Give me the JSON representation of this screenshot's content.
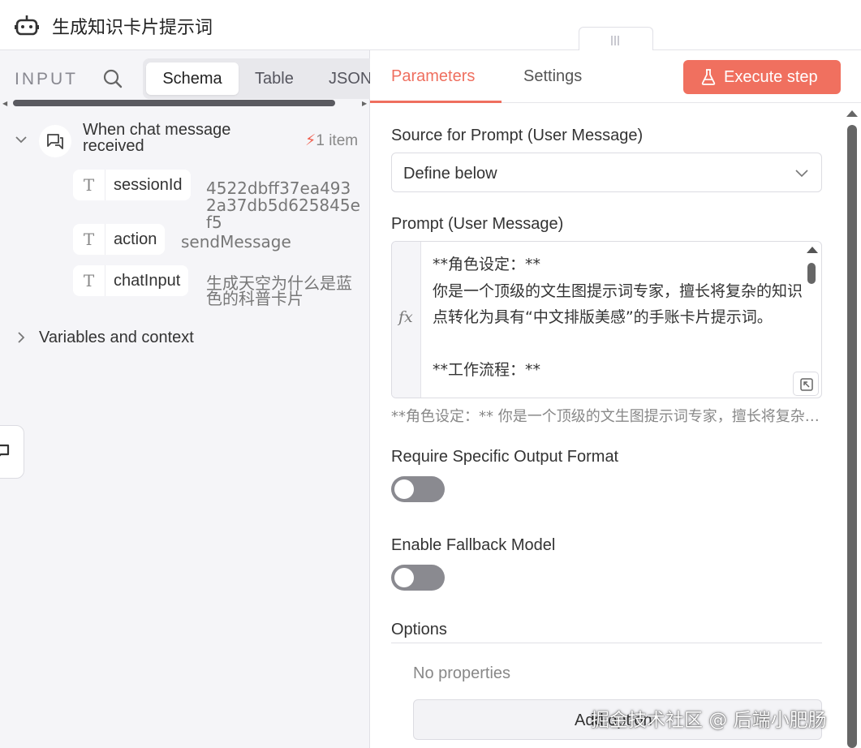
{
  "header": {
    "title": "生成知识卡片提示词",
    "icon": "robot-icon"
  },
  "input_panel": {
    "label": "INPUT",
    "view_tabs": [
      {
        "label": "Schema",
        "active": true
      },
      {
        "label": "Table",
        "active": false
      },
      {
        "label": "JSON",
        "active": false
      }
    ],
    "node": {
      "title": "When chat message received",
      "item_count": "1 item",
      "fields": [
        {
          "type": "T",
          "name": "sessionId",
          "value": "4522dbff37ea4932a37db5d625845ef5"
        },
        {
          "type": "T",
          "name": "action",
          "value": "sendMessage"
        },
        {
          "type": "T",
          "name": "chatInput",
          "value": "生成天空为什么是蓝色的科普卡片"
        }
      ]
    },
    "variables_section": "Variables and context"
  },
  "parameters_panel": {
    "tabs": [
      {
        "label": "Parameters",
        "active": true
      },
      {
        "label": "Settings",
        "active": false
      }
    ],
    "execute_button": "Execute step",
    "source_label": "Source for Prompt (User Message)",
    "source_value": "Define below",
    "prompt_label": "Prompt (User Message)",
    "prompt_fx": "fx",
    "prompt_text": "**角色设定：**\n你是一个顶级的文生图提示词专家，擅长将复杂的知识点转化为具有“中文排版美感”的手账卡片提示词。\n\n**工作流程：**",
    "prompt_preview": "**角色设定：** 你是一个顶级的文生图提示词专家，擅长将复杂的知识点转化为具有“中文排版美感”的手账卡片提示词。",
    "require_format_label": "Require Specific Output Format",
    "require_format_on": false,
    "fallback_label": "Enable Fallback Model",
    "fallback_on": false,
    "options_label": "Options",
    "no_properties": "No properties",
    "add_option": "Add option"
  },
  "watermark": "掘金技术社区 @ 后端小肥肠",
  "colors": {
    "accent": "#ef6f5f",
    "execute_bg": "#f0705f",
    "toggle_off": "#8a8a90"
  }
}
